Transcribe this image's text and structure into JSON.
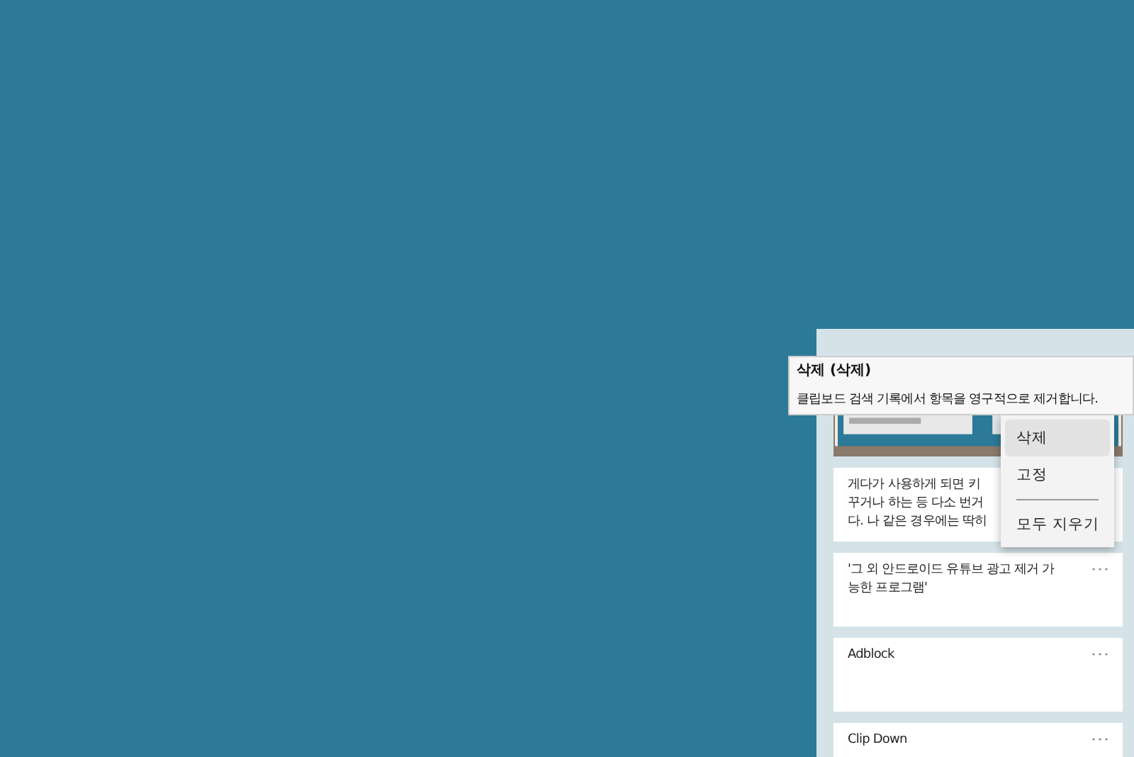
{
  "clipboard_panel": {
    "items": [
      {
        "kind": "picture"
      },
      {
        "kind": "text",
        "lines": [
          "게다가 사용하게 되면 키",
          "꾸거나 하는 등 다소 번거",
          "다. 나 같은 경우에는 딱히"
        ]
      },
      {
        "kind": "text",
        "lines": [
          "'그 외 안드로이드 유튜브 광고 제거 가",
          "능한 프로그램'"
        ]
      },
      {
        "kind": "text",
        "lines": [
          "Adblock"
        ]
      },
      {
        "kind": "text",
        "lines": [
          "Clip Down"
        ]
      }
    ]
  },
  "context_menu": {
    "items": [
      {
        "label": "삭제",
        "selected": true
      },
      {
        "label": "고정",
        "selected": false
      },
      {
        "kind": "separator"
      },
      {
        "label": "모두 지우기",
        "selected": false
      }
    ]
  },
  "tooltip": {
    "title": "삭제 (삭제)",
    "description": "클립보드 검색 기록에서 항목을 영구적으로 제거합니다."
  }
}
